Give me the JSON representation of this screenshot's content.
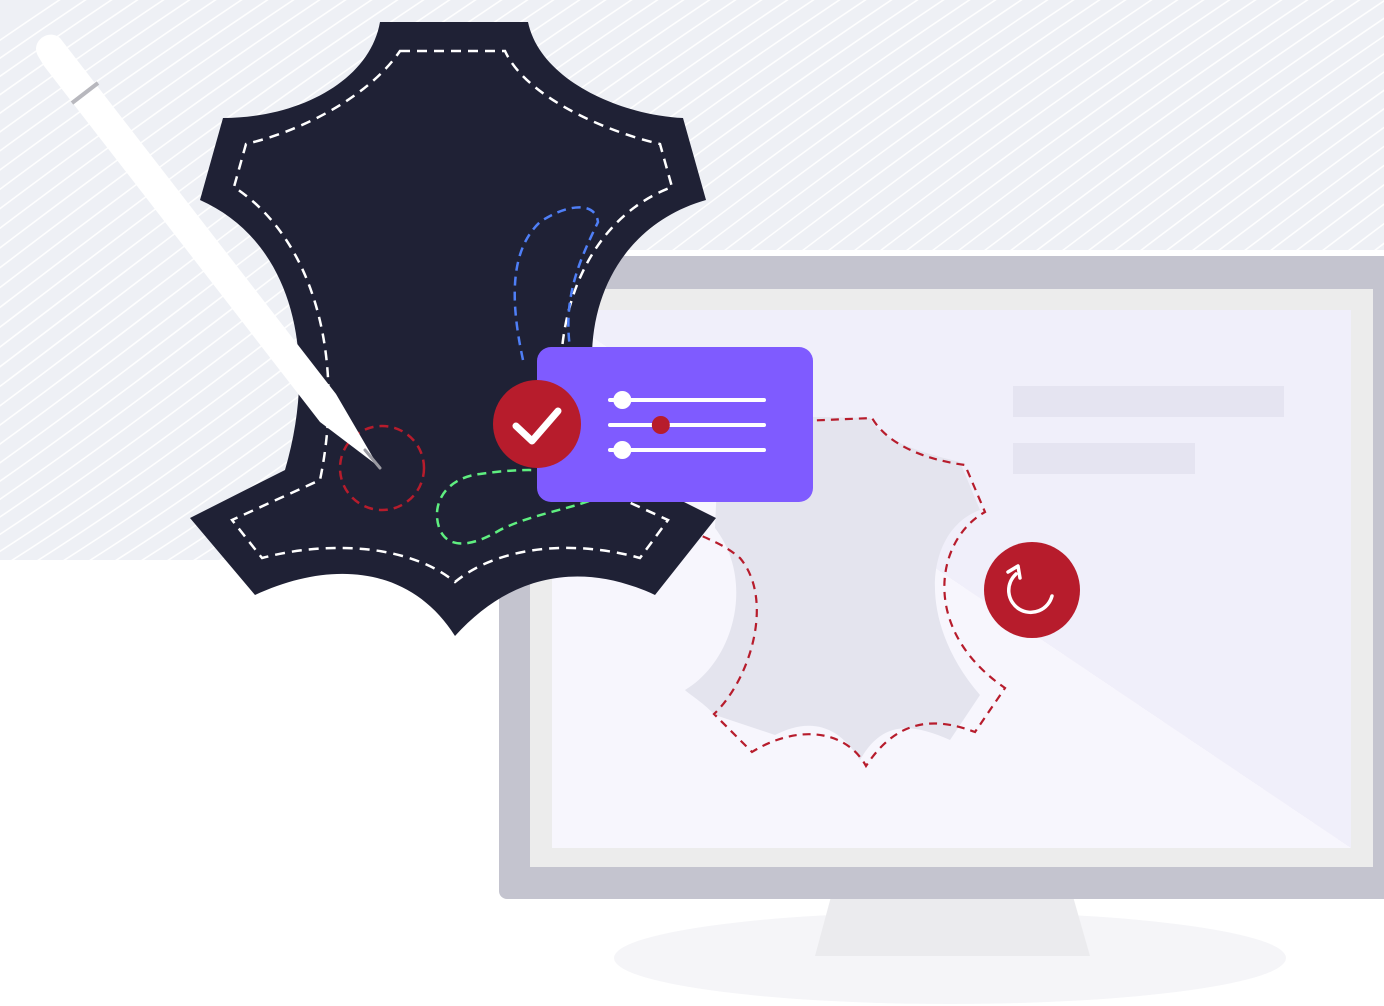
{
  "colors": {
    "background": "#ffffff",
    "wave_band": "#eef0f5",
    "wave_line": "#ffffff",
    "leather_dark": "#1f2135",
    "stitch_white": "#ffffff",
    "stitch_blue": "#4f7ff7",
    "stitch_green": "#5fef80",
    "stitch_red": "#b71c2c",
    "accent_red": "#b71c2c",
    "panel_purple": "#7f5bff",
    "monitor_frame": "#c4c4cf",
    "monitor_bezel": "#ececec",
    "monitor_screen": "#f7f6fd",
    "monitor_stand": "#ebebee",
    "floor_shadow": "#f5f5f8",
    "screen_placeholder": "#e5e4f1",
    "screen_leather_fill": "#e4e4ee",
    "pen_body": "#ffffff",
    "pen_band": "#b8b8be"
  },
  "icons": {
    "check_badge": "checkmark-icon",
    "refresh_badge": "refresh-icon",
    "sliders": "sliders-icon",
    "pen": "stylus-pen-icon",
    "leather_hide": "leather-hide-icon",
    "monitor": "monitor-icon"
  },
  "sliders": {
    "values": [
      0.08,
      0.33,
      0.08
    ],
    "knob_colors": [
      "#ffffff",
      "#b71c2c",
      "#ffffff"
    ]
  }
}
